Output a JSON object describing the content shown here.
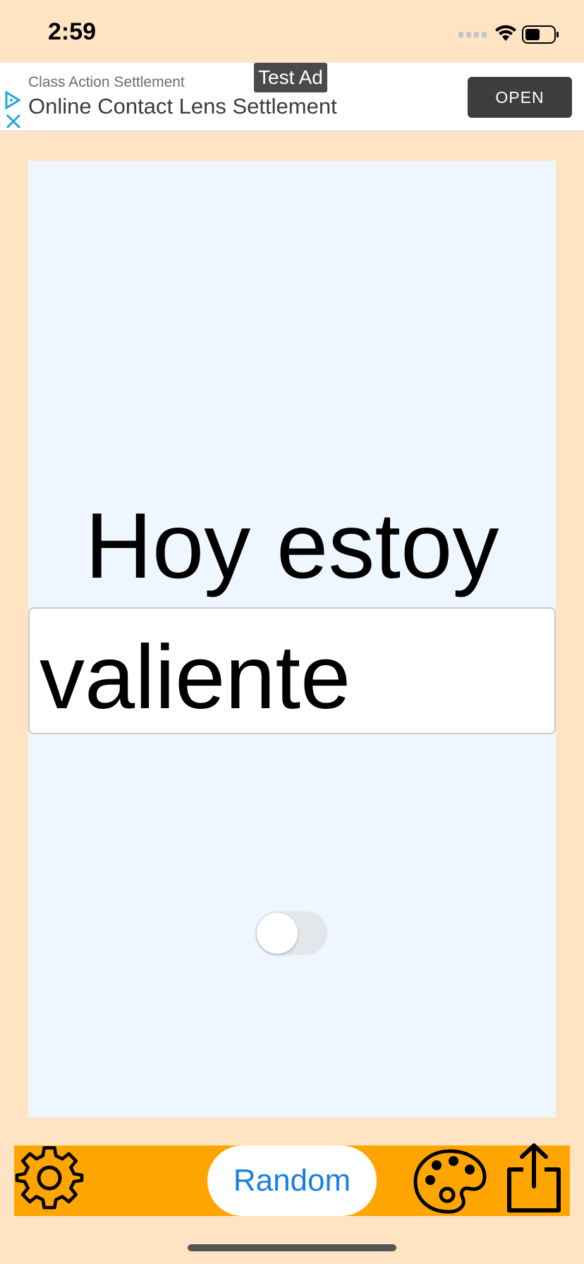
{
  "status_bar": {
    "time": "2:59",
    "icons": [
      "signal-icon",
      "wifi-icon",
      "battery-icon"
    ]
  },
  "ad": {
    "badge": "Test Ad",
    "headline": "Class Action Settlement",
    "title": "Online Contact Lens Settlement",
    "open_label": "OPEN",
    "icons": [
      "ad-choices-icon",
      "ad-close-icon"
    ]
  },
  "card": {
    "prompt": "Hoy estoy",
    "answer_value": "valiente",
    "toggle_on": false
  },
  "toolbar": {
    "random_label": "Random",
    "icons": [
      "settings-icon",
      "palette-icon",
      "share-icon"
    ]
  },
  "colors": {
    "page_background": "#FFE4C4",
    "card_background": "#EEF6FF",
    "toolbar_background": "#FFA500",
    "accent_blue": "#1A7FE0"
  }
}
